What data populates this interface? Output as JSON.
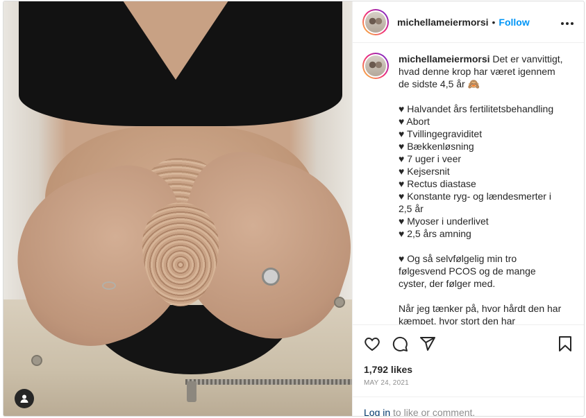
{
  "post": {
    "username": "michellameiermorsi",
    "header_dot": "•",
    "follow_label": "Follow",
    "more_label": "•••",
    "caption_text": "Det er vanvittigt, hvad denne krop har været igennem de sidste 4,5 år 🙈\n\n♥ Halvandet års fertilitetsbehandling\n♥ Abort\n♥ Tvillingegraviditet\n♥ Bækkenløsning\n♥ 7 uger i veer\n♥ Kejsersnit\n♥ Rectus diastase\n♥ Konstante ryg- og lændesmerter i 2,5 år\n♥ Myoser i underlivet\n♥ 2,5 års amning\n\n♥ Og så selvfølgelig min tro følgesvend PCOS og de mange cyster, der følger med.\n\nNår jeg tænker på, hvor hårdt den har kæmpet, hvor stort den har",
    "likes": "1,792 likes",
    "date": "MAY 24, 2021",
    "login_link": "Log in",
    "login_suffix": " to like or comment."
  },
  "icons": {
    "like": "heart-icon",
    "comment": "comment-icon",
    "share": "share-icon",
    "save": "bookmark-icon",
    "user_tag": "user-icon",
    "more": "more-options-icon"
  },
  "colors": {
    "accent": "#0095f6",
    "link": "#00376b",
    "muted": "#8e8e8e",
    "text": "#262626",
    "border": "#dbdbdb"
  }
}
